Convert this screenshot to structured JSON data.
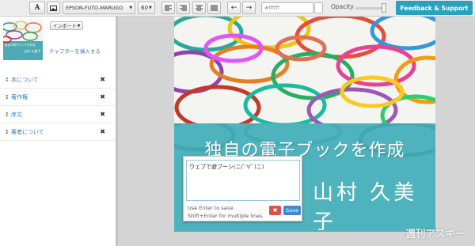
{
  "toolbar": {
    "font_value": "EPSON-FUTO-MARUGO",
    "size_value": "60",
    "color_value": "#ffffff",
    "opacity_label": "Opacity",
    "feedback_label": "Feedback & Support"
  },
  "sidebar": {
    "thumbnail": {
      "title": "独自の電子ブックを作成",
      "author": "山村 久美子"
    },
    "import_label": "インポート",
    "insert_chapter_label": "チャプターを挿入する",
    "chapters": [
      {
        "label": "本について"
      },
      {
        "label": "著作権"
      },
      {
        "label": "序文"
      },
      {
        "label": "著者について"
      }
    ]
  },
  "cover": {
    "title": "独自の電子ブックを作成",
    "author": "山村 久美子",
    "band_color": "#4fb3bd"
  },
  "editor": {
    "text": "ウェブで遊ブーシ(ニ(ﾟ∀ﾟ)ニ)",
    "help_line1": "Use Enter to save.",
    "help_line2": "Shift+Enter for multiple lines.",
    "cancel_label": "✖",
    "save_label": "Save"
  },
  "watermark": "週刊アスキー",
  "colors": {
    "accent": "#28a2bf",
    "save": "#428bca",
    "cancel": "#d9534f",
    "link": "#2a7fbf"
  }
}
